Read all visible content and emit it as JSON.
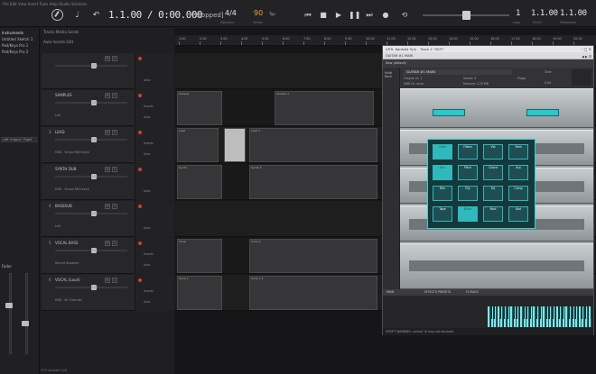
{
  "topbar": {
    "menu": "File  Edit  View  Insert  Tools  Help   Studio Sessions",
    "time": "1.1.00 / 0:00.000",
    "transport_state": "[Stopped]",
    "signature": "4/4",
    "signature_label": "Signature",
    "bpm": "90",
    "bpm_label": "Tempo",
    "tap_label": "Tap",
    "right_time_1": "1",
    "right_time_2": "1.1.00",
    "right_time_3": "1.1.00",
    "right_sub_1": "Loop",
    "right_sub_2": "Punch",
    "right_sub_3": "Metronome",
    "accent_color": "#f1a033"
  },
  "inspector": {
    "items": [
      "Instruments",
      "Untitled Sketch 1",
      "Pad/Keys Pro 1",
      "Pad/Keys Pro 2"
    ],
    "selected_index": 0,
    "output_dropdown": "Left Output / Right",
    "fader_label": "Fader"
  },
  "trackheader": {
    "tool_row_1": "Tracks  Media  Sends",
    "tool_row_2": "Auto  Inserts  Edit",
    "tracks": [
      {
        "num": "",
        "name": "",
        "sub": "",
        "vol": "0.00"
      },
      {
        "num": "",
        "name": "SAMPLES",
        "sub": "Left",
        "vol": "0.00"
      },
      {
        "num": "3",
        "name": "LEAD",
        "sub": "MIDI - Virtual MIDI Keyb",
        "vol": "0.00"
      },
      {
        "num": "",
        "name": "SYNTH DUB",
        "sub": "MIDI - Virtual MIDI Keyb",
        "vol": "0.00"
      },
      {
        "num": "4",
        "name": "BASSSUB",
        "sub": "Left",
        "vol": "0.00"
      },
      {
        "num": "5",
        "name": "VOCAL BASS",
        "sub": "Record Disabled",
        "vol": "0.00"
      },
      {
        "num": "6",
        "name": "VOCAL (Loud)",
        "sub": "MIDI - All Channels",
        "vol": "0.00"
      }
    ],
    "side_labels": [
      "Auto",
      "Inserts"
    ]
  },
  "ruler": {
    "ticks": [
      "1.00",
      "2.00",
      "3.00",
      "4.00",
      "5.00",
      "6.00",
      "7.00",
      "8.00",
      "9.00",
      "10.00",
      "11.00",
      "12.00",
      "13.00",
      "14.00",
      "15.00",
      "16.00",
      "17.00",
      "18.00",
      "19.00",
      "20.00"
    ]
  },
  "clips": [
    {
      "lane": 1,
      "label": "Sample"
    },
    {
      "lane": 1,
      "label": "Sample 2"
    },
    {
      "lane": 2,
      "label": "Lead"
    },
    {
      "lane": 2,
      "label": "Lead 2"
    },
    {
      "lane": 2,
      "label": "Lead 3"
    },
    {
      "lane": 3,
      "label": "Synth"
    },
    {
      "lane": 3,
      "label": "Synth 2"
    },
    {
      "lane": 5,
      "label": "Vocal"
    },
    {
      "lane": 5,
      "label": "Vocal 2"
    },
    {
      "lane": 6,
      "label": "Vocal L"
    },
    {
      "lane": 6,
      "label": "Vocal L 2"
    }
  ],
  "plugin": {
    "title": "VSTi: Kontakt 5(4) - Track 2 \"VSTi\"",
    "preset_field": "GUITAR #1 MAIN",
    "bar3": "New (default)",
    "side_label": "Multi Rack",
    "instrument_name": "GUITAR #1 MAIN",
    "output_label": "Output: st. 1",
    "midi_label": "MIDI Ch: omni",
    "voices_label": "Voices: 0",
    "memory_label": "Memory: 2.25 MB",
    "purge_label": "Purge",
    "tune_label": "Tune",
    "tune_value": "0.00",
    "grid_labels": [
      "Hold",
      "Filters",
      "Vib",
      "Trem",
      "Env",
      "Pitch",
      "Chord",
      "Arp",
      "Rev",
      "Dly",
      "Eq",
      "Comp",
      "Tape",
      "Drive",
      "Mod",
      "Kbd"
    ],
    "tabs": [
      "MAIN",
      "EFFECTS PRESETS",
      "FX RACK"
    ],
    "status": "SCRIPT WARNING: control 10 may not declared",
    "accent_color": "#2ec7c9"
  },
  "bottom_status": "VSTi Kontakt 5(4)"
}
